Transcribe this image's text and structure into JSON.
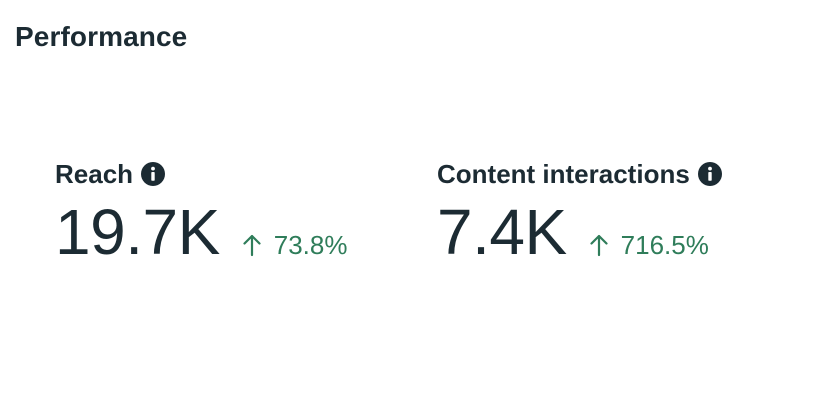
{
  "section": {
    "title": "Performance"
  },
  "metrics": [
    {
      "label": "Reach",
      "info_icon": "info-icon",
      "value": "19.7K",
      "change": "73.8%",
      "change_icon": "arrow-up-icon"
    },
    {
      "label": "Content interactions",
      "info_icon": "info-icon",
      "value": "7.4K",
      "change": "716.5%",
      "change_icon": "arrow-up-icon"
    }
  ],
  "colors": {
    "text": "#1c2b33",
    "positive": "#2f7d5a",
    "background": "#ffffff"
  }
}
